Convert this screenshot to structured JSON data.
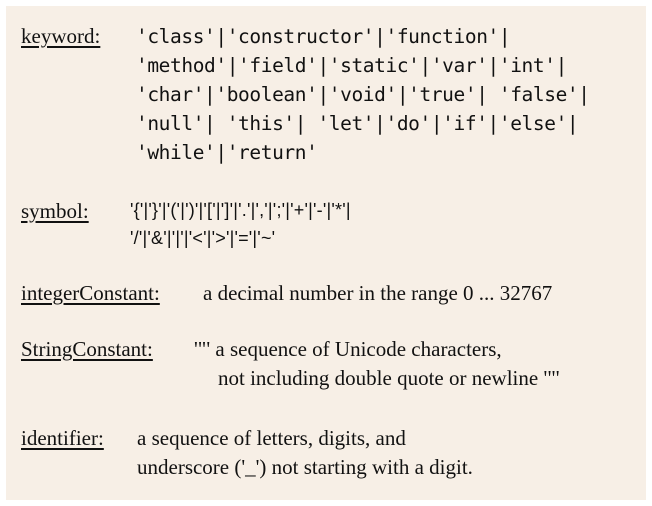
{
  "keyword": {
    "label": "keyword:",
    "lines": [
      "'class'|'constructor'|'function'|",
      "'method'|'field'|'static'|'var'|'int'|",
      "'char'|'boolean'|'void'|'true'| 'false'|",
      "'null'| 'this'| 'let'|'do'|'if'|'else'|",
      "'while'|'return'"
    ]
  },
  "symbol": {
    "label": "symbol:",
    "lines": [
      "'{'|'}'|'('|')'|'['|']'|'.'|','|';'|'+'|'-'|'*'|",
      "'/'|'&'|'|'|'<'|'>'|'='|'~'"
    ]
  },
  "integerConstant": {
    "label": "integerConstant:",
    "text": "a decimal number in the range 0 ... 32767"
  },
  "stringConstant": {
    "label": "StringConstant:",
    "lines": [
      "'\"' a sequence of Unicode characters,",
      "not including double quote or newline '\"'"
    ]
  },
  "identifier": {
    "label": "identifier:",
    "lines": [
      "a sequence of letters, digits, and",
      "underscore ('_') not starting with a digit."
    ]
  }
}
